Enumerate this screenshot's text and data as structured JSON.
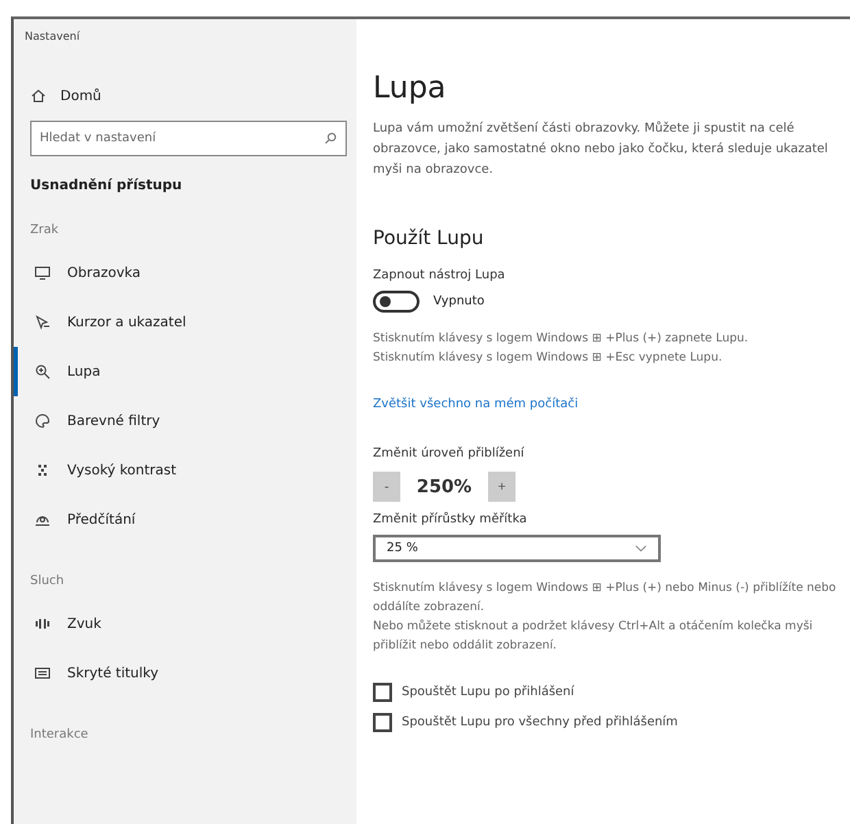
{
  "window": {
    "title": "Nastavení"
  },
  "sidebar": {
    "home": "Domů",
    "search": {
      "placeholder": "Hledat v nastavení"
    },
    "section_title": "Usnadnění přístupu",
    "groups": [
      {
        "label": "Zrak",
        "items": [
          {
            "label": "Obrazovka",
            "kind": "monitor",
            "selected": false
          },
          {
            "label": "Kurzor a ukazatel",
            "kind": "pointer",
            "selected": false
          },
          {
            "label": "Lupa",
            "kind": "magnifier",
            "selected": true
          },
          {
            "label": "Barevné filtry",
            "kind": "palette",
            "selected": false
          },
          {
            "label": "Vysoký kontrast",
            "kind": "contrast",
            "selected": false
          },
          {
            "label": "Předčítání",
            "kind": "narrator",
            "selected": false
          }
        ]
      },
      {
        "label": "Sluch",
        "items": [
          {
            "label": "Zvuk",
            "kind": "speaker",
            "selected": false
          },
          {
            "label": "Skryté titulky",
            "kind": "captions",
            "selected": false
          }
        ]
      },
      {
        "label": "Interakce"
      }
    ]
  },
  "main": {
    "title": "Lupa",
    "description": "Lupa vám umožní zvětšení části obrazovky. Můžete ji spustit na celé obrazovce, jako samostatné okno nebo jako čočku, která sleduje ukazatel myši na obrazovce.",
    "section": "Použít Lupu",
    "toggle": {
      "label": "Zapnout nástroj Lupa",
      "on": false,
      "state_text": "Vypnuto"
    },
    "shortcut_lines": [
      "Stisknutím klávesy s logem Windows ⊞ +Plus (+) zapnete Lupu.",
      "Stisknutím klávesy s logem Windows ⊞ +Esc vypnete Lupu."
    ],
    "link": "Zvětšit všechno na mém počítači",
    "zoom_level": {
      "label": "Změnit úroveň přiblížení",
      "minus": "-",
      "value": "250%",
      "plus": "+"
    },
    "zoom_increment": {
      "label": "Změnit přírůstky měřítka",
      "value": "25 %"
    },
    "help_lines": [
      "Stisknutím klávesy s logem Windows ⊞ +Plus (+) nebo Minus (-) přiblížíte nebo oddálíte zobrazení.",
      "Nebo můžete stisknout a podržet klávesy Ctrl+Alt a otáčením kolečka myši přiblížit nebo oddálit zobrazení."
    ],
    "checkboxes": [
      {
        "label": "Spouštět Lupu po přihlášení",
        "checked": false
      },
      {
        "label": "Spouštět Lupu pro všechny před přihlášením",
        "checked": false
      }
    ]
  }
}
